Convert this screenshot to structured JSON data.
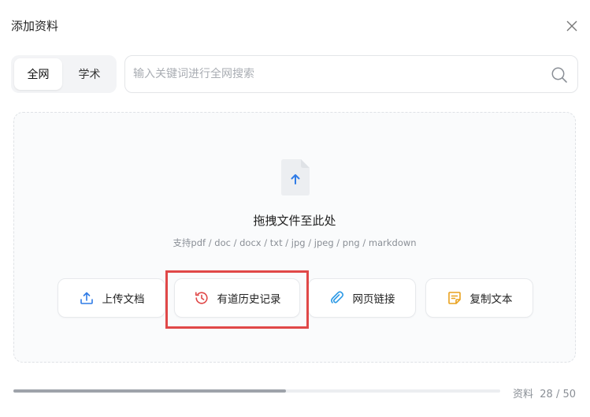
{
  "dialog": {
    "title": "添加资料"
  },
  "tabs": [
    {
      "label": "全网",
      "active": true
    },
    {
      "label": "学术",
      "active": false
    }
  ],
  "search": {
    "placeholder": "输入关键词进行全网搜索",
    "value": ""
  },
  "dropzone": {
    "title": "拖拽文件至此处",
    "formats": "支持pdf / doc / docx / txt / jpg / jpeg / png / markdown"
  },
  "actions": [
    {
      "label": "上传文档",
      "icon": "upload-icon",
      "color": "#2f7be6"
    },
    {
      "label": "有道历史记录",
      "icon": "history-icon",
      "color": "#e04848"
    },
    {
      "label": "网页链接",
      "icon": "link-icon",
      "color": "#2f9be6"
    },
    {
      "label": "复制文本",
      "icon": "note-icon",
      "color": "#e9a21f"
    }
  ],
  "footer": {
    "count_label": "资料",
    "count_value": "28 / 50",
    "progress": 0.56
  },
  "colors": {
    "highlight": "#e04848",
    "accent": "#2f7be6"
  }
}
